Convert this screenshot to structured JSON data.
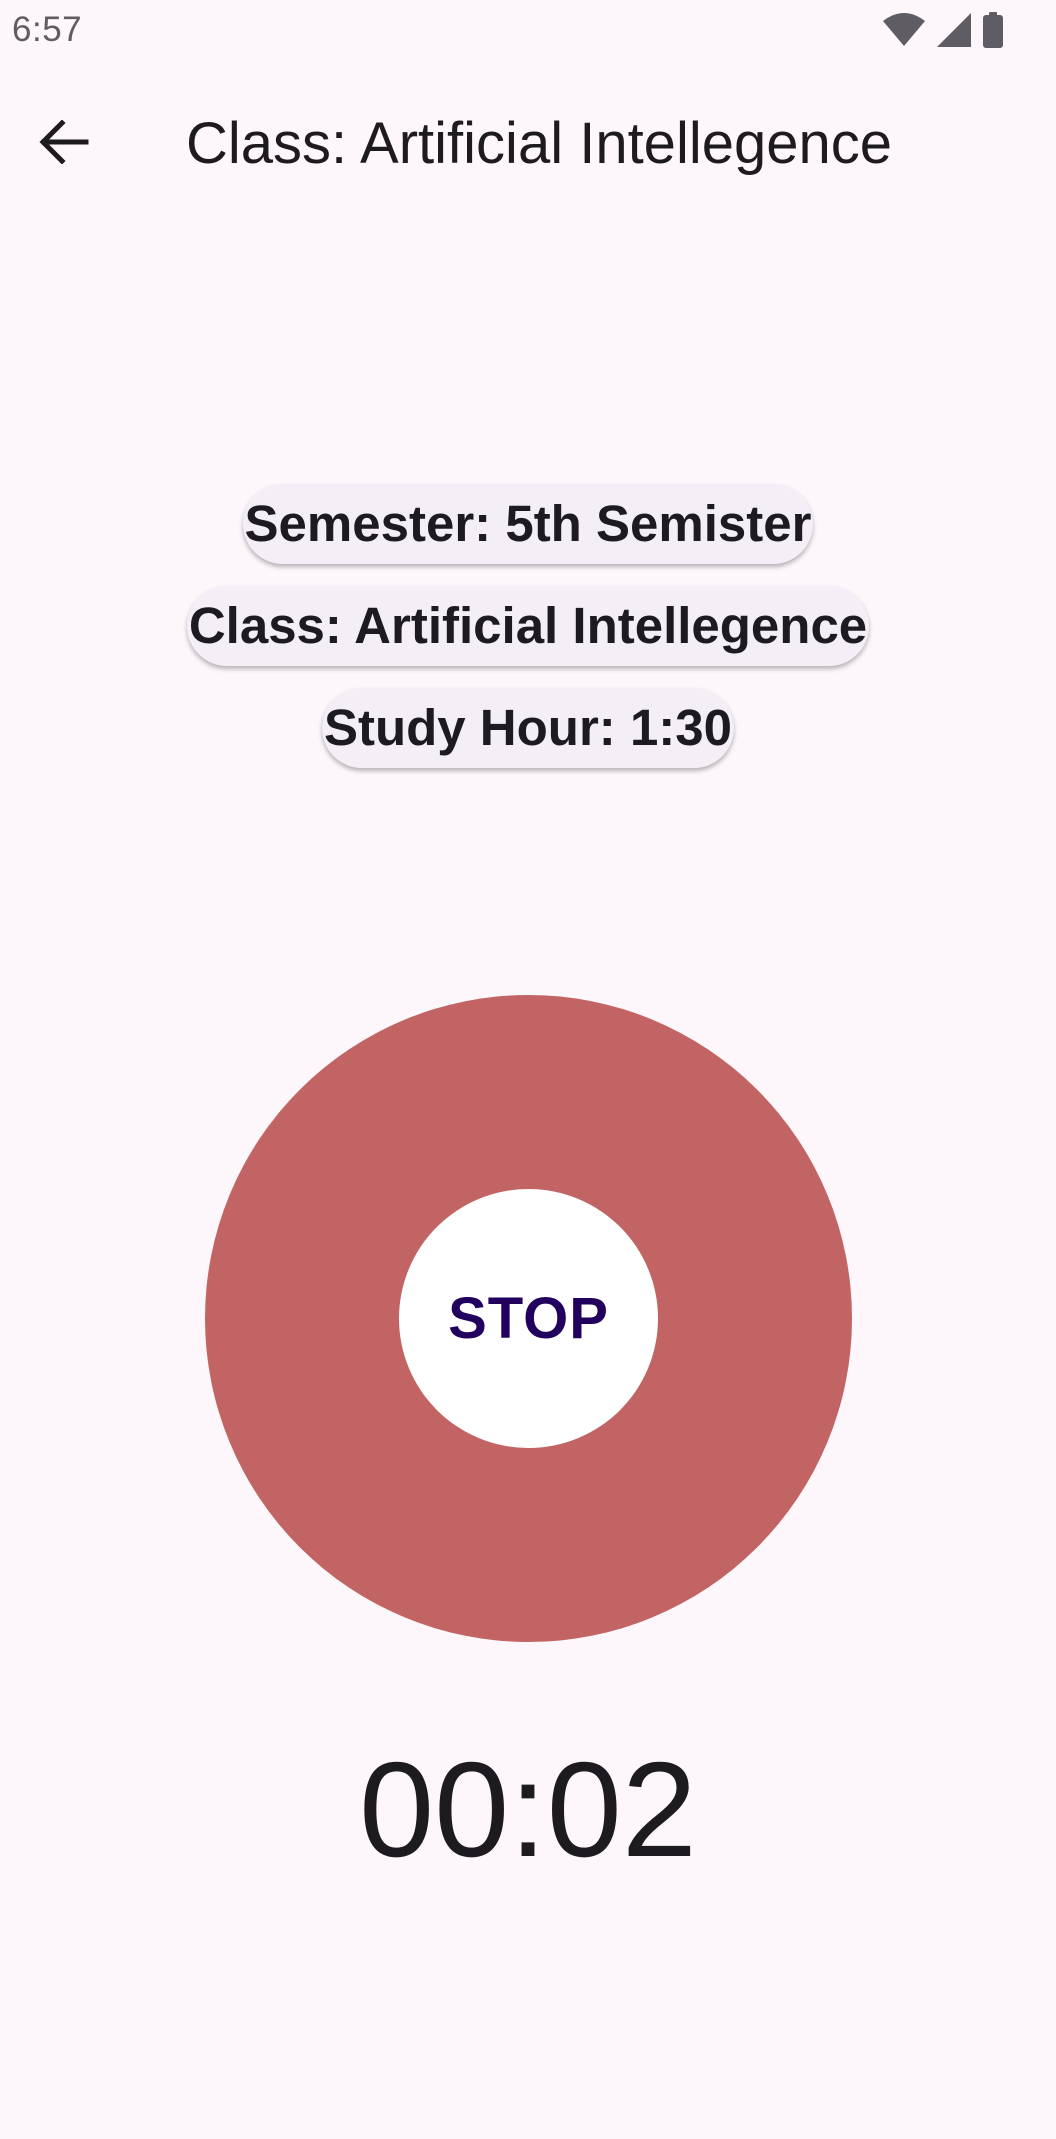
{
  "status_bar": {
    "time": "6:57",
    "icons": [
      "wifi-icon",
      "signal-icon",
      "battery-icon"
    ]
  },
  "app_bar": {
    "back_icon": "arrow-back-icon",
    "title": "Class: Artificial Intellegence"
  },
  "info": {
    "semester": "Semester: 5th Semister",
    "class": "Class: Artificial Intellegence",
    "study_hour": "Study Hour: 1:30"
  },
  "timer_button": {
    "label": "STOP",
    "ring_color": "#c16463",
    "label_color": "#22005d"
  },
  "timer": {
    "elapsed": "00:02"
  },
  "colors": {
    "background": "#fdf7fb",
    "chip_background": "#f4eef6",
    "text": "#1d1b20"
  }
}
